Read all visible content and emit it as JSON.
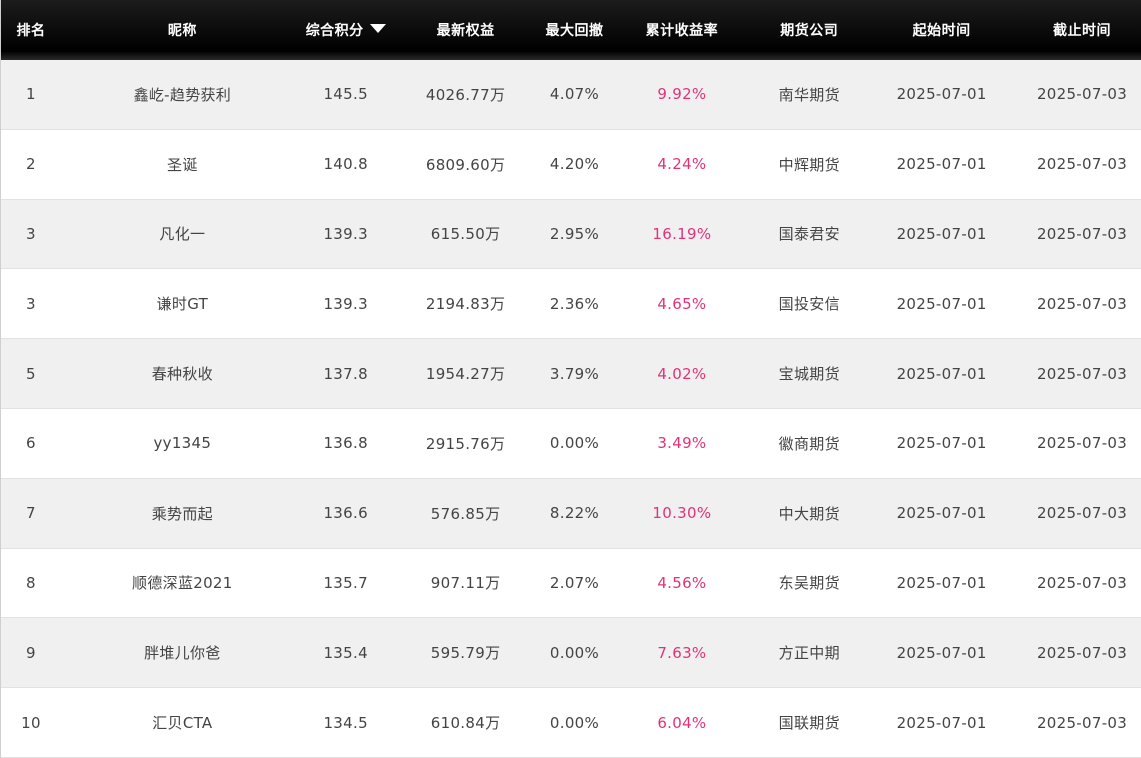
{
  "columns": {
    "rank": "排名",
    "nickname": "昵称",
    "score": "综合积分",
    "equity": "最新权益",
    "drawdown": "最大回撤",
    "return": "累计收益率",
    "broker": "期货公司",
    "start": "起始时间",
    "end": "截止时间"
  },
  "sort": {
    "column": "score",
    "direction": "desc",
    "icon": "caret-down-icon"
  },
  "colors": {
    "header_bg": "#000000",
    "return_text": "#e0327a",
    "odd_row": "#f0f0f0"
  },
  "rows": [
    {
      "rank": "1",
      "nickname": "鑫屹-趋势获利",
      "score": "145.5",
      "equity": "4026.77万",
      "drawdown": "4.07%",
      "return": "9.92%",
      "broker": "南华期货",
      "start": "2025-07-01",
      "end": "2025-07-03"
    },
    {
      "rank": "2",
      "nickname": "圣诞",
      "score": "140.8",
      "equity": "6809.60万",
      "drawdown": "4.20%",
      "return": "4.24%",
      "broker": "中辉期货",
      "start": "2025-07-01",
      "end": "2025-07-03"
    },
    {
      "rank": "3",
      "nickname": "凡化一",
      "score": "139.3",
      "equity": "615.50万",
      "drawdown": "2.95%",
      "return": "16.19%",
      "broker": "国泰君安",
      "start": "2025-07-01",
      "end": "2025-07-03"
    },
    {
      "rank": "3",
      "nickname": "谦时GT",
      "score": "139.3",
      "equity": "2194.83万",
      "drawdown": "2.36%",
      "return": "4.65%",
      "broker": "国投安信",
      "start": "2025-07-01",
      "end": "2025-07-03"
    },
    {
      "rank": "5",
      "nickname": "春种秋收",
      "score": "137.8",
      "equity": "1954.27万",
      "drawdown": "3.79%",
      "return": "4.02%",
      "broker": "宝城期货",
      "start": "2025-07-01",
      "end": "2025-07-03"
    },
    {
      "rank": "6",
      "nickname": "yy1345",
      "score": "136.8",
      "equity": "2915.76万",
      "drawdown": "0.00%",
      "return": "3.49%",
      "broker": "徽商期货",
      "start": "2025-07-01",
      "end": "2025-07-03"
    },
    {
      "rank": "7",
      "nickname": "乘势而起",
      "score": "136.6",
      "equity": "576.85万",
      "drawdown": "8.22%",
      "return": "10.30%",
      "broker": "中大期货",
      "start": "2025-07-01",
      "end": "2025-07-03"
    },
    {
      "rank": "8",
      "nickname": "顺德深蓝2021",
      "score": "135.7",
      "equity": "907.11万",
      "drawdown": "2.07%",
      "return": "4.56%",
      "broker": "东吴期货",
      "start": "2025-07-01",
      "end": "2025-07-03"
    },
    {
      "rank": "9",
      "nickname": "胖堆儿你爸",
      "score": "135.4",
      "equity": "595.79万",
      "drawdown": "0.00%",
      "return": "7.63%",
      "broker": "方正中期",
      "start": "2025-07-01",
      "end": "2025-07-03"
    },
    {
      "rank": "10",
      "nickname": "汇贝CTA",
      "score": "134.5",
      "equity": "610.84万",
      "drawdown": "0.00%",
      "return": "6.04%",
      "broker": "国联期货",
      "start": "2025-07-01",
      "end": "2025-07-03"
    }
  ]
}
